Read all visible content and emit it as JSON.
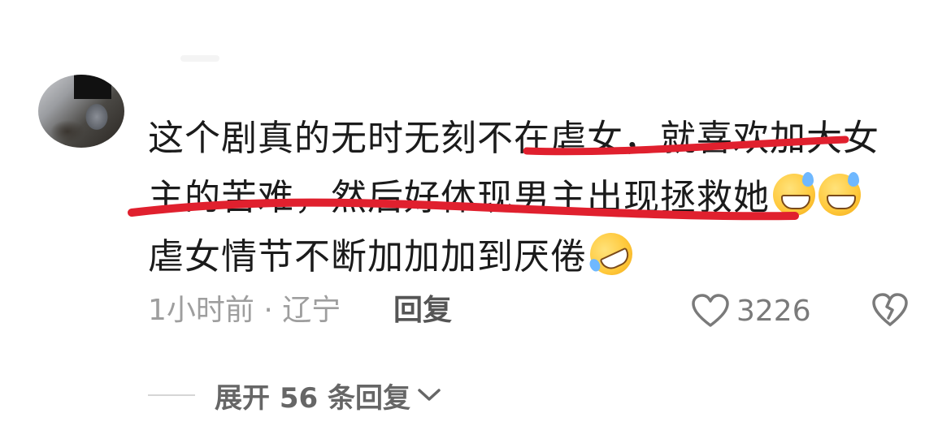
{
  "comment": {
    "line1": "这个剧真的无时无刻不在虐女，就喜欢加大女",
    "line2": "主的苦难，然后好体现男主出现拯救她",
    "line3": "虐女情节不断加加加到厌倦",
    "emoji_line2": [
      "grinning-sweat-emoji",
      "grinning-sweat-emoji"
    ],
    "emoji_line3": "rolling-laughing-emoji"
  },
  "meta": {
    "time": "1小时前",
    "separator": "·",
    "location": "辽宁",
    "reply_label": "回复"
  },
  "actions": {
    "like_count": "3226",
    "like_icon": "heart-icon",
    "dislike_icon": "broken-heart-icon"
  },
  "expand": {
    "label": "展开 56 条回复",
    "icon": "chevron-down-icon"
  },
  "colors": {
    "annotation": "#e0202e",
    "text": "#1b1b1b",
    "meta": "#9e9e9e"
  }
}
